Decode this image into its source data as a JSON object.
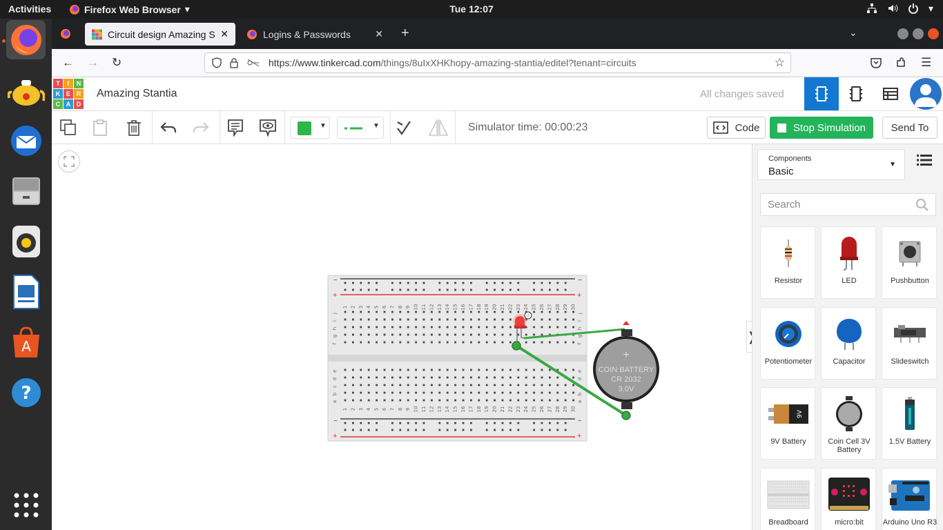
{
  "system": {
    "activities": "Activities",
    "app_name": "Firefox Web Browser",
    "clock": "Tue 12:07"
  },
  "browser": {
    "tabs": [
      {
        "title": "Circuit design Amazing St"
      },
      {
        "title": "Logins & Passwords"
      }
    ],
    "url": "https://www.tinkercad.com/things/8uIxXHKhopy-amazing-stantia/editel?tenant=circuits",
    "url_host": "https://www.tinkercad.com",
    "url_path": "/things/8uIxXHKhopy-amazing-stantia/editel?tenant=circuits"
  },
  "tinkercad": {
    "logo_letters": [
      "T",
      "I",
      "N",
      "K",
      "E",
      "R",
      "C",
      "A",
      "D"
    ],
    "design_title": "Amazing Stantia",
    "save_status": "All changes saved"
  },
  "toolbar": {
    "simulator_time": "Simulator time: 00:00:23",
    "code_label": "Code",
    "stop_label": "Stop Simulation",
    "send_label": "Send To",
    "fill_color": "#2fb54a"
  },
  "breadboard": {
    "column_numbers": [
      "1",
      "2",
      "3",
      "4",
      "5",
      "6",
      "7",
      "8",
      "9",
      "10",
      "11",
      "12",
      "13",
      "14",
      "15",
      "16",
      "17",
      "18",
      "19",
      "20",
      "21",
      "22",
      "23",
      "24",
      "25",
      "26",
      "27",
      "28",
      "29",
      "30"
    ],
    "rows_top": [
      "j",
      "i",
      "h",
      "g",
      "f"
    ],
    "rows_bottom": [
      "e",
      "d",
      "c",
      "b",
      "a"
    ]
  },
  "battery": {
    "plus": "+",
    "line1": "COIN BATTERY",
    "line2": "CR 2032",
    "line3": "3.0V"
  },
  "panel": {
    "components_label": "Components",
    "components_value": "Basic",
    "search_placeholder": "Search",
    "components": [
      {
        "name": "Resistor"
      },
      {
        "name": "LED"
      },
      {
        "name": "Pushbutton"
      },
      {
        "name": "Potentiometer"
      },
      {
        "name": "Capacitor"
      },
      {
        "name": "Slideswitch"
      },
      {
        "name": "9V Battery"
      },
      {
        "name": "Coin Cell 3V Battery"
      },
      {
        "name": "1.5V Battery"
      },
      {
        "name": "Breadboard"
      },
      {
        "name": "micro:bit"
      },
      {
        "name": "Arduino Uno R3"
      }
    ]
  },
  "colors": {
    "accent": "#1477d1",
    "sim_green": "#24b35a",
    "wire_green": "#3aa844",
    "led_red": "#e53935"
  }
}
